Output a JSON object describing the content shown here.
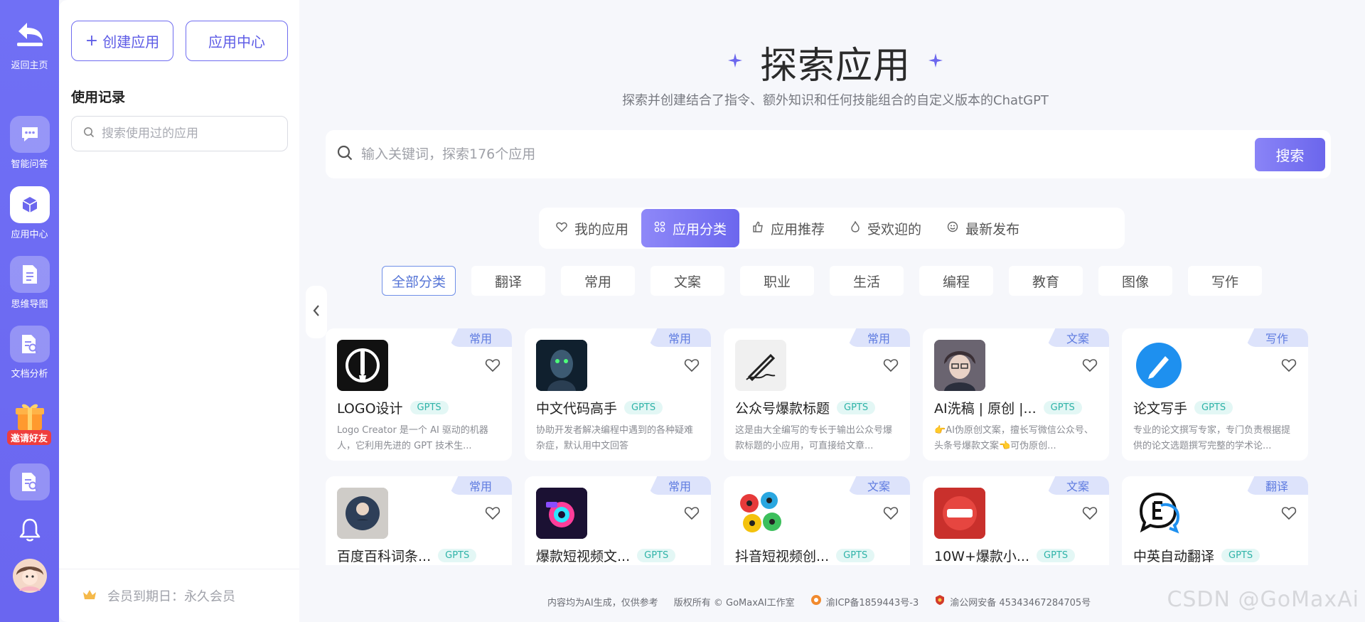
{
  "rail": {
    "home_label": "返回主页",
    "items": [
      {
        "label": "智能问答",
        "icon": "chat-icon"
      },
      {
        "label": "应用中心",
        "icon": "cube-icon"
      },
      {
        "label": "思维导图",
        "icon": "mindmap-doc-icon"
      },
      {
        "label": "文档分析",
        "icon": "doc-search-icon"
      }
    ],
    "invite_label": "邀请好友"
  },
  "side": {
    "create_label": "创建应用",
    "center_label": "应用中心",
    "history_title": "使用记录",
    "search_placeholder": "搜索使用过的应用",
    "membership": "会员到期日：永久会员"
  },
  "hero": {
    "title": "探索应用",
    "subtitle": "探索并创建结合了指令、额外知识和任何技能组合的自定义版本的ChatGPT"
  },
  "search": {
    "placeholder": "输入关键词，探索176个应用",
    "button": "搜索"
  },
  "tabs": [
    {
      "label": "我的应用",
      "icon": "heart-icon"
    },
    {
      "label": "应用分类",
      "icon": "grid-icon"
    },
    {
      "label": "应用推荐",
      "icon": "thumbs-up-icon"
    },
    {
      "label": "受欢迎的",
      "icon": "flame-icon"
    },
    {
      "label": "最新发布",
      "icon": "smile-icon"
    }
  ],
  "categories": [
    "全部分类",
    "翻译",
    "常用",
    "文案",
    "职业",
    "生活",
    "编程",
    "教育",
    "图像",
    "写作"
  ],
  "cards": [
    {
      "tag": "常用",
      "title": "LOGO设计",
      "badge": "GPTS",
      "desc": "Logo Creator 是一个 AI 驱动的机器人，它利用先进的 GPT 技术生...",
      "icon": "brush-logo-icon"
    },
    {
      "tag": "常用",
      "title": "中文代码高手",
      "badge": "GPTS",
      "desc": "协助开发者解决编程中遇到的各种疑难杂症，默认用中文回答",
      "icon": "robot-portrait-icon"
    },
    {
      "tag": "常用",
      "title": "公众号爆款标题",
      "badge": "GPTS",
      "desc": "这是由大全编写的专长于输出公众号爆款标题的小应用，可直接给文章...",
      "icon": "pen-sketch-icon"
    },
    {
      "tag": "文案",
      "title": "AI洗稿 | 原创 |...",
      "badge": "GPTS",
      "desc": "👉AI伪原创文案，擅长写微信公众号、头条号爆款文案👈可伪原创...",
      "icon": "anime-portrait-icon"
    },
    {
      "tag": "写作",
      "title": "论文写手",
      "badge": "GPTS",
      "desc": "专业的论文撰写专家，专门负责根据提供的论文选题撰写完整的学术论...",
      "icon": "pen-circle-icon"
    },
    {
      "tag": "常用",
      "title": "百度百科词条...",
      "badge": "GPTS",
      "desc": "",
      "icon": "reference-badge-icon"
    },
    {
      "tag": "常用",
      "title": "爆款短视频文...",
      "badge": "GPTS",
      "desc": "",
      "icon": "camera-neon-icon"
    },
    {
      "tag": "文案",
      "title": "抖音短视频创...",
      "badge": "GPTS",
      "desc": "",
      "icon": "film-reels-icon"
    },
    {
      "tag": "文案",
      "title": "10W+爆款小...",
      "badge": "GPTS",
      "desc": "",
      "icon": "xiaohongshu-icon"
    },
    {
      "tag": "翻译",
      "title": "中英自动翻译",
      "badge": "GPTS",
      "desc": "",
      "icon": "translate-bubble-icon"
    }
  ],
  "footer": {
    "ai_note": "内容均为AI生成，仅供参考",
    "copyright": "版权所有 © GoMaxAI工作室",
    "icp": "渝ICP备1859443号-3",
    "police": "渝公网安备 45343467284705号"
  },
  "watermark": "CSDN @GoMaxAi",
  "colors": {
    "accent": "#6c67ee",
    "rail": "#6f6cf3",
    "tag_bg": "#dde3fb",
    "gpts": "#2fb3a8"
  }
}
